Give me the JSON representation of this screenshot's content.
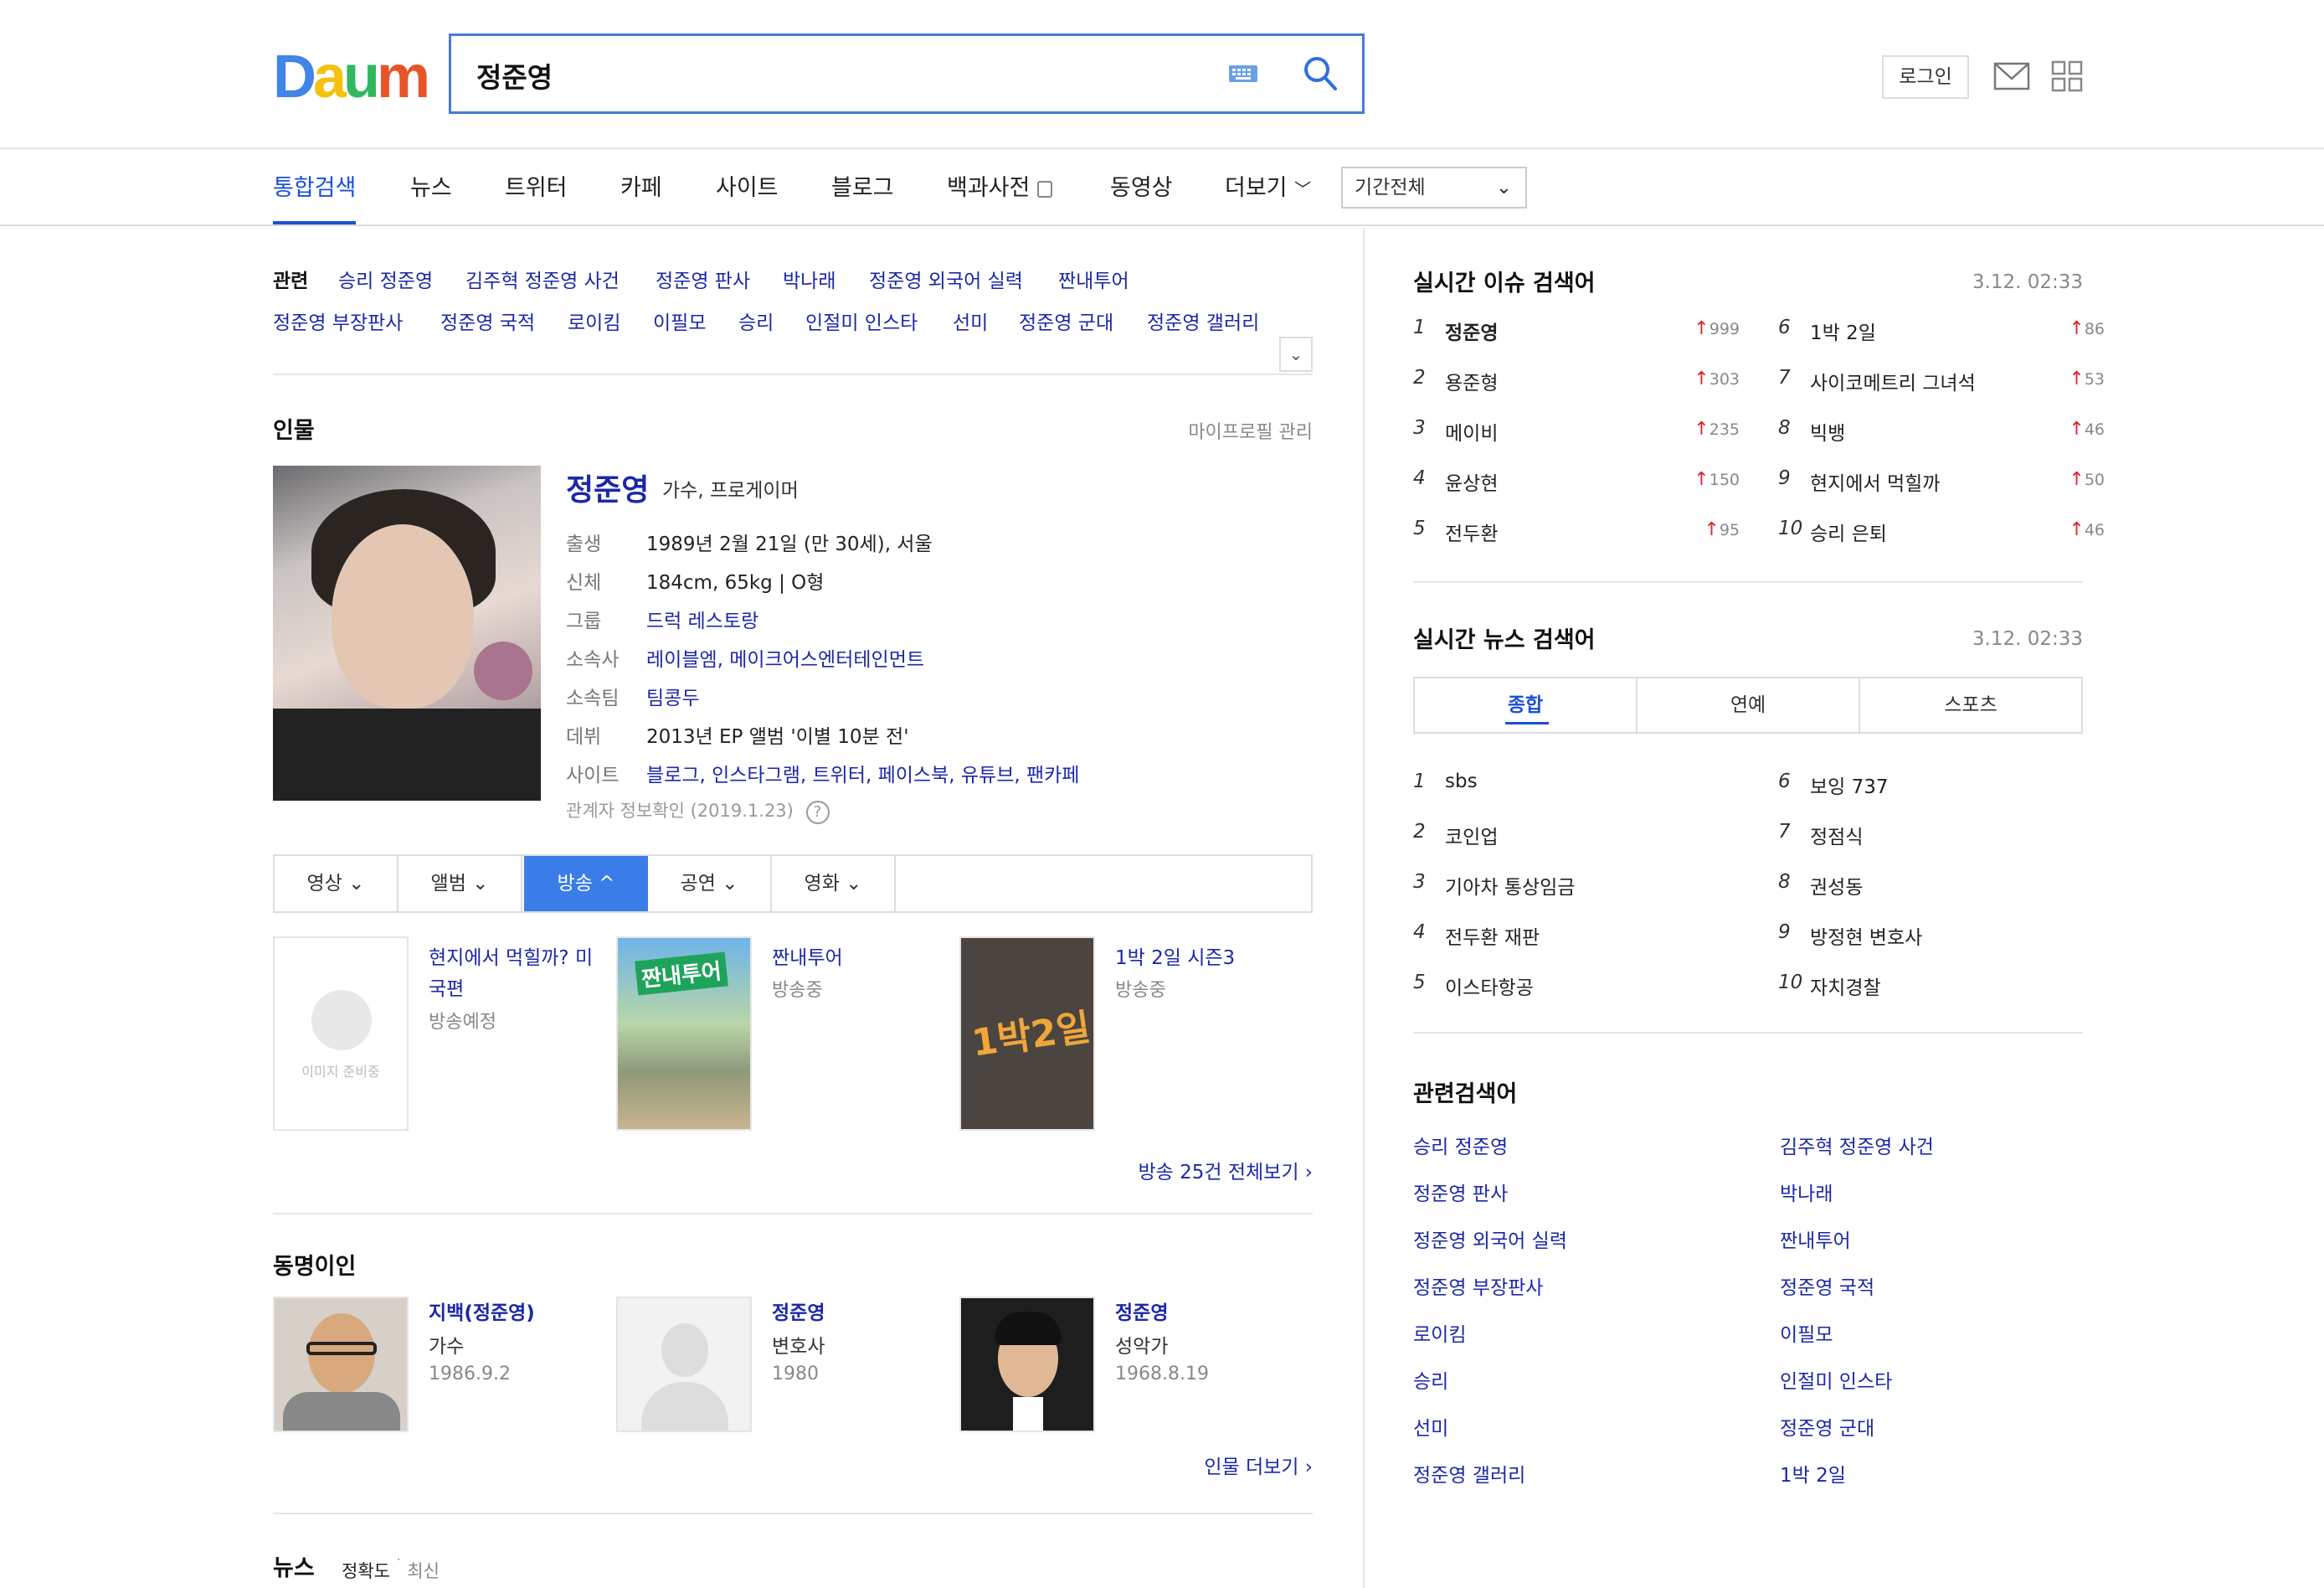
{
  "header": {
    "logo": [
      "D",
      "a",
      "u",
      "m"
    ],
    "logo_colors": [
      "#4285e8",
      "#f4c20d",
      "#2fb85e",
      "#e8542a"
    ],
    "search_value": "정준영",
    "login_label": "로그인"
  },
  "tabs": {
    "items": [
      "통합검색",
      "뉴스",
      "트위터",
      "카페",
      "사이트",
      "블로그",
      "백과사전",
      "동영상",
      "더보기"
    ],
    "active": "통합검색",
    "period": "기간전체"
  },
  "related_top": {
    "label": "관련",
    "row1": [
      "승리 정준영",
      "김주혁 정준영 사건",
      "정준영 판사",
      "박나래",
      "정준영 외국어 실력",
      "짠내투어"
    ],
    "row2": [
      "정준영 부장판사",
      "정준영 국적",
      "로이킴",
      "이필모",
      "승리",
      "인절미 인스타",
      "선미",
      "정준영 군대",
      "정준영 갤러리"
    ]
  },
  "person": {
    "section_title": "인물",
    "profile_manage": "마이프로필 관리",
    "name": "정준영",
    "role": "가수, 프로게이머",
    "rows": [
      {
        "k": "출생",
        "v": "1989년 2월 21일 (만 30세), 서울"
      },
      {
        "k": "신체",
        "v": "184cm, 65kg  |  O형"
      },
      {
        "k": "그룹",
        "v": "드럭 레스토랑"
      },
      {
        "k": "소속사",
        "v": "레이블엠, 메이크어스엔터테인먼트"
      },
      {
        "k": "소속팀",
        "v": "팀콩두"
      },
      {
        "k": "데뷔",
        "v": "2013년 EP 앨범 '이별 10분 전'"
      },
      {
        "k": "사이트",
        "v": "블로그, 인스타그램, 트위터, 페이스북, 유튜브, 팬카페"
      }
    ],
    "verify": "관계자 정보확인 (2019.1.23)"
  },
  "media_tabs": [
    "영상",
    "앨범",
    "방송",
    "공연",
    "영화"
  ],
  "media_active": "방송",
  "broadcasts": [
    {
      "title": "현지에서 먹힐까? 미국편",
      "status": "방송예정",
      "thumb": "이미지 준비중"
    },
    {
      "title": "짠내투어",
      "status": "방송중",
      "thumb": "짠내투어"
    },
    {
      "title": "1박 2일 시즌3",
      "status": "방송중",
      "thumb": "1박2일"
    }
  ],
  "broadcast_more": "방송 25건 전체보기",
  "namesake": {
    "title": "동명이인",
    "people": [
      {
        "name": "지백(정준영)",
        "job": "가수",
        "date": "1986.9.2"
      },
      {
        "name": "정준영",
        "job": "변호사",
        "date": "1980"
      },
      {
        "name": "정준영",
        "job": "성악가",
        "date": "1968.8.19"
      }
    ],
    "more": "인물 더보기"
  },
  "news": {
    "title": "뉴스",
    "sort_a": "정확도",
    "sort_b": "최신"
  },
  "issue": {
    "title": "실시간 이슈 검색어",
    "time": "3.12. 02:33",
    "items": [
      {
        "n": "1",
        "t": "정준영",
        "c": "999"
      },
      {
        "n": "2",
        "t": "용준형",
        "c": "303"
      },
      {
        "n": "3",
        "t": "메이비",
        "c": "235"
      },
      {
        "n": "4",
        "t": "윤상현",
        "c": "150"
      },
      {
        "n": "5",
        "t": "전두환",
        "c": "95"
      },
      {
        "n": "6",
        "t": "1박 2일",
        "c": "86"
      },
      {
        "n": "7",
        "t": "사이코메트리 그녀석",
        "c": "53"
      },
      {
        "n": "8",
        "t": "빅뱅",
        "c": "46"
      },
      {
        "n": "9",
        "t": "현지에서 먹힐까",
        "c": "50"
      },
      {
        "n": "10",
        "t": "승리 은퇴",
        "c": "46"
      }
    ]
  },
  "news_rank": {
    "title": "실시간 뉴스 검색어",
    "time": "3.12. 02:33",
    "tabs": [
      "종합",
      "연예",
      "스포츠"
    ],
    "items": [
      {
        "n": "1",
        "t": "sbs"
      },
      {
        "n": "2",
        "t": "코인업"
      },
      {
        "n": "3",
        "t": "기아차 통상임금"
      },
      {
        "n": "4",
        "t": "전두환 재판"
      },
      {
        "n": "5",
        "t": "이스타항공"
      },
      {
        "n": "6",
        "t": "보잉 737"
      },
      {
        "n": "7",
        "t": "정점식"
      },
      {
        "n": "8",
        "t": "권성동"
      },
      {
        "n": "9",
        "t": "방정현 변호사"
      },
      {
        "n": "10",
        "t": "자치경찰"
      }
    ]
  },
  "related_right": {
    "title": "관련검색어",
    "col1": [
      "승리 정준영",
      "정준영 판사",
      "정준영 외국어 실력",
      "정준영 부장판사",
      "로이킴",
      "승리",
      "선미",
      "정준영 갤러리"
    ],
    "col2": [
      "김주혁 정준영 사건",
      "박나래",
      "짠내투어",
      "정준영 국적",
      "이필모",
      "인절미 인스타",
      "정준영 군대",
      "1박 2일"
    ]
  }
}
